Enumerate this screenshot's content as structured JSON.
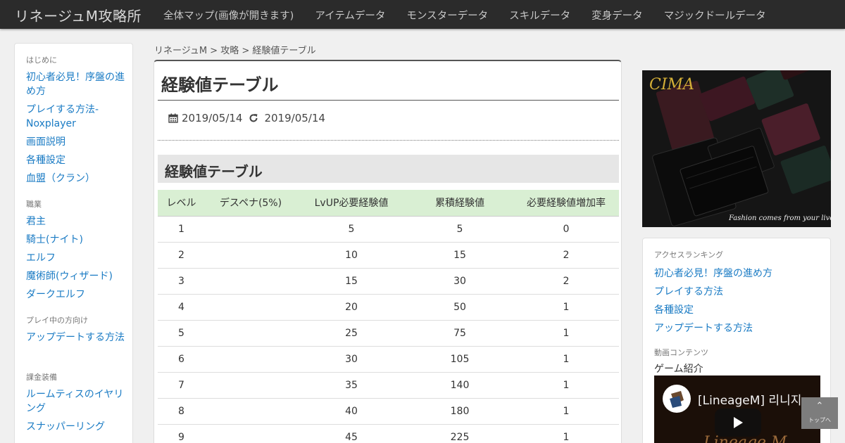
{
  "header": {
    "site_title": "リネージュM攻略所",
    "nav": [
      "全体マップ(画像が開きます)",
      "アイテムデータ",
      "モンスターデータ",
      "スキルデータ",
      "変身データ",
      "マジックドールデータ"
    ]
  },
  "sidebar": {
    "sections": [
      {
        "heading": "はじめに",
        "items": [
          "初心者必見！序盤の進め方",
          "プレイする方法-Noxplayer",
          "画面説明",
          "各種設定",
          "血盟（クラン）"
        ]
      },
      {
        "heading": "職業",
        "items": [
          "君主",
          "騎士(ナイト)",
          "エルフ",
          "魔術師(ウィザード)",
          "ダークエルフ"
        ]
      },
      {
        "heading": "プレイ中の方向け",
        "items": [
          "アップデートする方法"
        ]
      },
      {
        "heading": "課金装備",
        "items": [
          "ルームティスのイヤリング",
          "スナッパーリング"
        ]
      }
    ]
  },
  "breadcrumb": {
    "home": "リネージュM",
    "sep": " > ",
    "section": "攻略",
    "current": "経験値テーブル"
  },
  "article": {
    "title": "経験値テーブル",
    "published": "2019/05/14",
    "updated": "2019/05/14",
    "section_heading": "経験値テーブル"
  },
  "table": {
    "headers": [
      "レベル",
      "デスペナ(5%)",
      "LvUP必要経験値",
      "累積経験値",
      "必要経験値増加率"
    ],
    "rows": [
      [
        "1",
        "",
        "5",
        "5",
        "0"
      ],
      [
        "2",
        "",
        "10",
        "15",
        "2"
      ],
      [
        "3",
        "",
        "15",
        "30",
        "2"
      ],
      [
        "4",
        "",
        "20",
        "50",
        "1"
      ],
      [
        "5",
        "",
        "25",
        "75",
        "1"
      ],
      [
        "6",
        "",
        "30",
        "105",
        "1"
      ],
      [
        "7",
        "",
        "35",
        "140",
        "1"
      ],
      [
        "8",
        "",
        "40",
        "180",
        "1"
      ],
      [
        "9",
        "",
        "45",
        "225",
        "1"
      ]
    ]
  },
  "ad": {
    "brand": "CIMA",
    "tagline": "Fashion comes from your lives."
  },
  "right_sidebar": {
    "ranking_heading": "アクセスランキング",
    "ranking": [
      "初心者必見！序盤の進め方",
      "プレイする方法",
      "各種設定",
      "アップデートする方法"
    ],
    "video_heading": "動画コンテンツ",
    "video_caption": "ゲーム紹介",
    "video_title": "[LineageM] 리니지",
    "video_logo": "Lineage M"
  },
  "back_to_top": {
    "label": "トップへ"
  },
  "colors": {
    "link": "#1a7bc4",
    "header_bg": "#2b2b2b",
    "table_header_bg": "#d9efd3"
  }
}
